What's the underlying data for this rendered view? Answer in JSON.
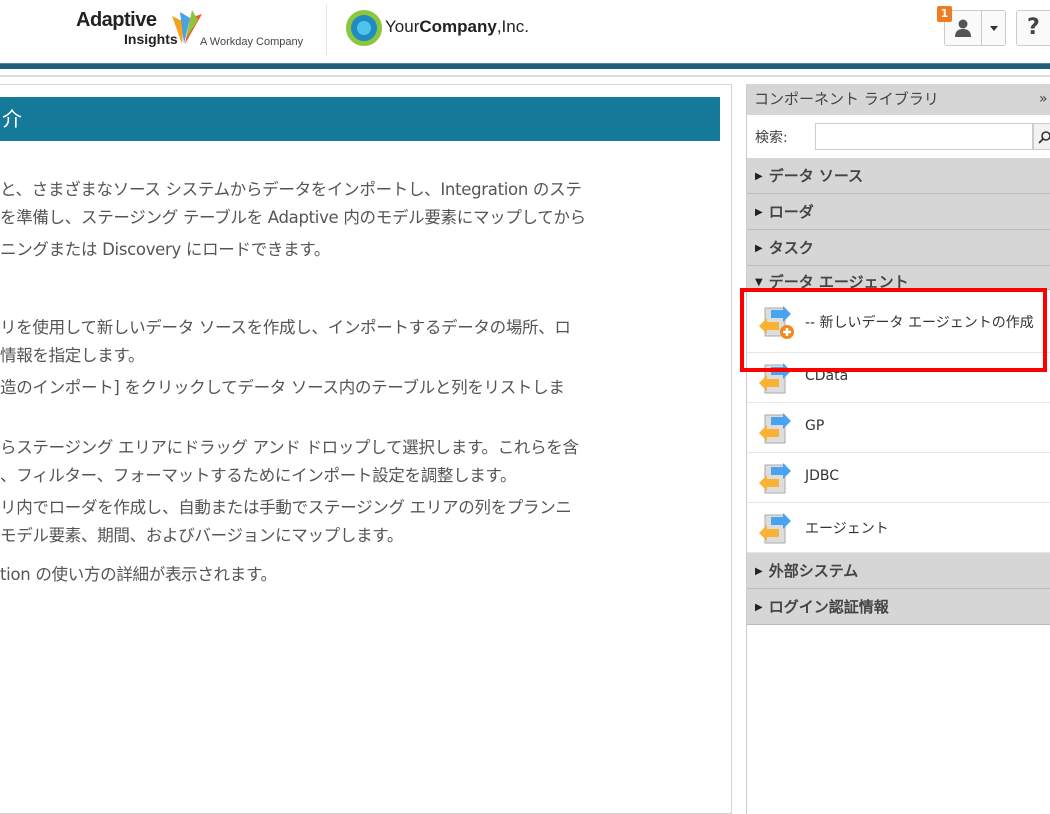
{
  "header": {
    "brand_name": "Adaptive",
    "brand_sub": "Insights",
    "brand_tagline": "A Workday Company",
    "company_name_plain": "Your",
    "company_name_bold": "Company",
    "company_suffix": ",Inc.",
    "notification_count": "1",
    "help_label": "?"
  },
  "main": {
    "title": "介",
    "lines": [
      "と、さまざまなソース システムからデータをインポートし、Integration のステ",
      "を準備し、ステージング テーブルを Adaptive 内のモデル要素にマップしてから",
      "ニングまたは Discovery にロードできます。",
      "リを使用して新しいデータ ソースを作成し、インポートするデータの場所、ロ",
      "情報を指定します。",
      "造のインポート] をクリックしてデータ ソース内のテーブルと列をリストしま",
      "らステージング エリアにドラッグ アンド ドロップして選択します。これらを含",
      "、フィルター、フォーマットするためにインポート設定を調整します。",
      "リ内でローダを作成し、自動または手動でステージング エリアの列をプランニ",
      "モデル要素、期間、およびバージョンにマップします。",
      "tion の使い方の詳細が表示されます。"
    ]
  },
  "library": {
    "title": "コンポーネント ライブラリ",
    "collapse_label": "»",
    "search_label": "検索:",
    "search_value": "",
    "sections": [
      {
        "label": "データ ソース",
        "expanded": false
      },
      {
        "label": "ローダ",
        "expanded": false
      },
      {
        "label": "タスク",
        "expanded": false
      },
      {
        "label": "データ エージェント",
        "expanded": true
      },
      {
        "label": "外部システム",
        "expanded": false
      },
      {
        "label": "ログイン認証情報",
        "expanded": false
      }
    ],
    "agent_items": [
      {
        "label": "-- 新しいデータ エージェントの作成"
      },
      {
        "label": "CData"
      },
      {
        "label": "GP"
      },
      {
        "label": "JDBC"
      },
      {
        "label": "エージェント"
      }
    ]
  },
  "colors": {
    "accent": "#15799a",
    "highlight": "#ff0000",
    "badge": "#f07c21"
  }
}
